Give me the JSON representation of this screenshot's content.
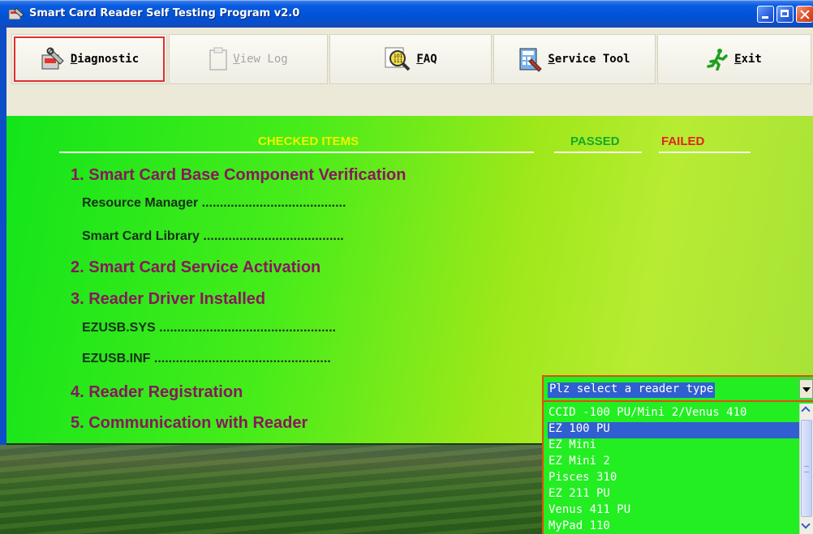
{
  "window": {
    "title": "Smart Card Reader Self Testing Program v2.0",
    "icons": [
      "app-icon",
      "minimize-icon",
      "maximize-icon",
      "close-icon"
    ]
  },
  "toolbar": {
    "buttons": [
      {
        "label": "Diagnostic",
        "icon": "diagnostic-tools-icon",
        "selected": true,
        "enabled": true
      },
      {
        "label": "View Log",
        "icon": "clipboard-icon",
        "enabled": false
      },
      {
        "label": "FAQ",
        "icon": "faq-magnifier-icon",
        "enabled": true
      },
      {
        "label": "Service Tool",
        "icon": "service-tool-icon",
        "enabled": true
      },
      {
        "label": "Exit",
        "icon": "running-man-icon",
        "enabled": true
      }
    ]
  },
  "checklist": {
    "headers": {
      "checked": "CHECKED ITEMS",
      "passed": "PASSED",
      "failed": "FAILED"
    },
    "items": [
      {
        "label": "1. Smart Card Base Component Verification",
        "level": 1
      },
      {
        "label": "Resource Manager ........................................",
        "level": 2
      },
      {
        "label": "Smart Card Library .......................................",
        "level": 2
      },
      {
        "label": "2. Smart Card Service Activation",
        "level": 1
      },
      {
        "label": "3. Reader Driver Installed",
        "level": 1
      },
      {
        "label": "EZUSB.SYS .................................................",
        "level": 2
      },
      {
        "label": "EZUSB.INF .................................................",
        "level": 2
      },
      {
        "label": "4. Reader Registration",
        "level": 1
      },
      {
        "label": "5. Communication with Reader",
        "level": 1
      }
    ]
  },
  "reader_select": {
    "value": "Plz select a reader type",
    "options": [
      "CCID -100 PU/Mini 2/Venus 410",
      "EZ 100 PU",
      "EZ Mini",
      "EZ Mini 2",
      "Pisces 310",
      "EZ 211 PU",
      "Venus 411 PU",
      "MyPad 110"
    ],
    "highlighted": "EZ 100 PU"
  },
  "colors": {
    "titlebar": "#0052d6",
    "panel_green": "#48ec1a",
    "heading_yellow": "#f2f200",
    "passed_green": "#16a82a",
    "failed_red": "#e02618",
    "item_purple": "#87185c",
    "list_bg": "#22ee22",
    "selection_blue": "#2f5fd0"
  }
}
